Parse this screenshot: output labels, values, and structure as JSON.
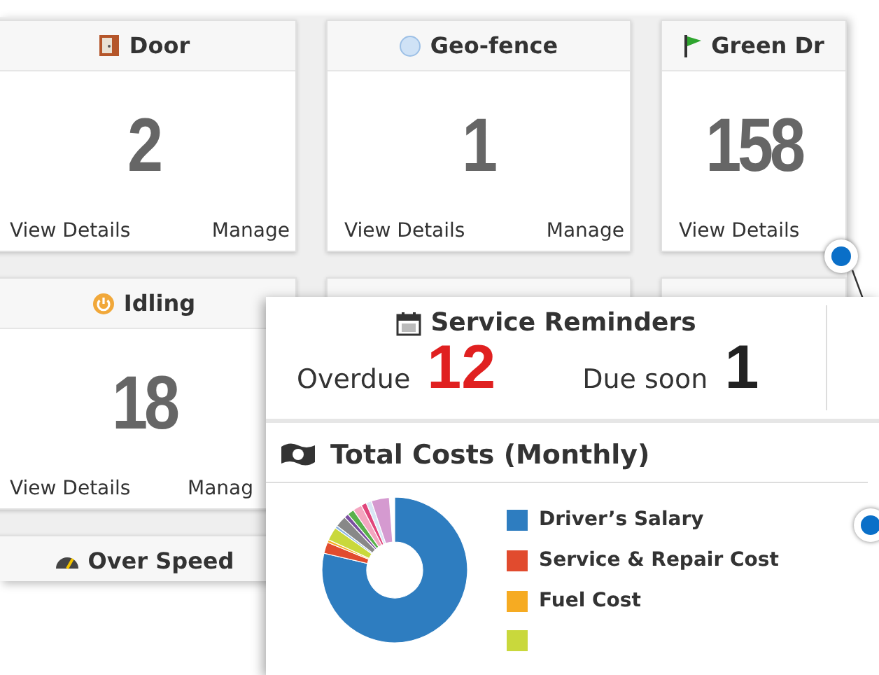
{
  "cards": [
    {
      "title": "Door",
      "value": "2",
      "links": [
        "View Details",
        "Manage"
      ]
    },
    {
      "title": "Geo-fence",
      "value": "1",
      "links": [
        "View Details",
        "Manage"
      ]
    },
    {
      "title": "Green Dr",
      "value": "158",
      "links": [
        "View Details"
      ]
    },
    {
      "title": "Idling",
      "value": "18",
      "links": [
        "View Details",
        "Manag"
      ]
    },
    {
      "title": "Over Speed"
    }
  ],
  "service_reminders": {
    "title": "Service Reminders",
    "overdue_label": "Overdue",
    "overdue_value": "12",
    "due_soon_label": "Due soon",
    "due_soon_value": "1"
  },
  "total_costs": {
    "title": "Total Costs (Monthly)",
    "legend": [
      {
        "label": "Driver’s Salary",
        "color": "#2e7dc0"
      },
      {
        "label": "Service & Repair Cost",
        "color": "#e14b2e"
      },
      {
        "label": "Fuel Cost",
        "color": "#f6ab22"
      },
      {
        "color": "#c9d83c"
      }
    ]
  }
}
